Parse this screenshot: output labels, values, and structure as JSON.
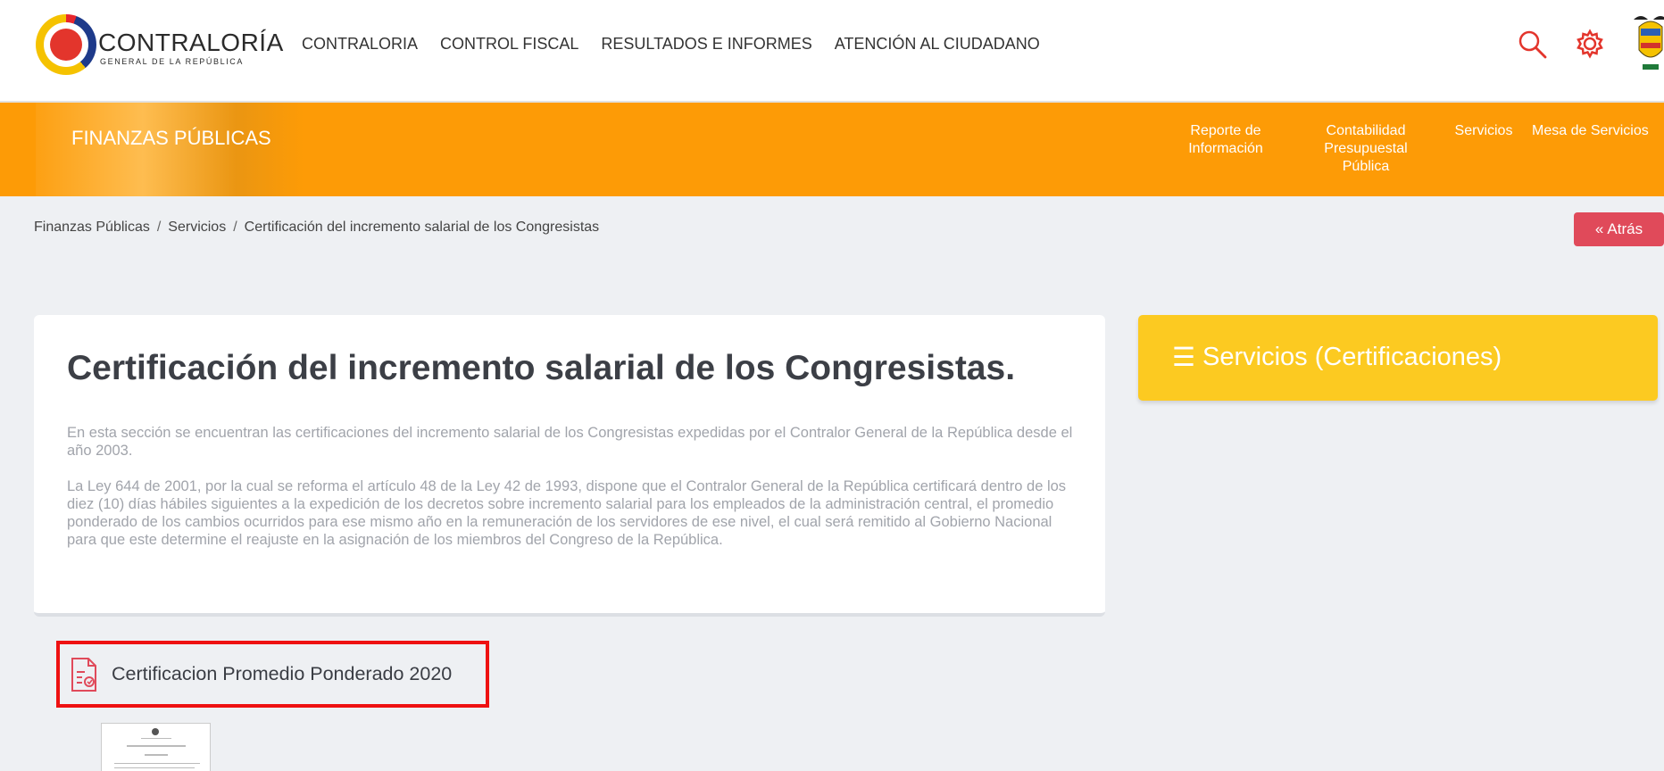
{
  "header": {
    "logo": {
      "title": "CONTRALORÍA",
      "subtitle": "GENERAL DE LA REPÚBLICA"
    },
    "nav": [
      "CONTRALORIA",
      "CONTROL FISCAL",
      "RESULTADOS E INFORMES",
      "ATENCIÓN AL CIUDADANO"
    ],
    "icons": {
      "search": "search-icon",
      "settings": "gear-icon",
      "crest": "coat-of-arms"
    },
    "accent_color": "#e3352c"
  },
  "band": {
    "title": "FINANZAS PÚBLICAS",
    "nav": [
      {
        "label": "Reporte de Información"
      },
      {
        "label": "Contabilidad Presupuestal Pública"
      },
      {
        "label": "Servicios"
      },
      {
        "label": "Mesa de Servicios"
      }
    ],
    "color": "#fd9b06"
  },
  "breadcrumb": [
    "Finanzas Públicas",
    "Servicios",
    "Certificación del incremento salarial de los Congresistas"
  ],
  "back_button": {
    "label": "Atrás",
    "icon": "«"
  },
  "main": {
    "title": "Certificación del incremento salarial de los Congresistas.",
    "paragraphs": [
      "En esta sección se encuentran las certificaciones del incremento salarial de los Congresistas expedidas por el Contralor General de la República desde el año 2003.",
      "La Ley 644 de 2001, por la cual se reforma el artículo 48 de la Ley 42 de 1993, dispone que el Contralor General de la República certificará dentro de los diez (10) días hábiles siguientes a la expedición de los decretos sobre incremento salarial para los empleados de la administración central, el promedio ponderado de los cambios ocurridos para ese mismo año en la remuneración de los servidores de ese nivel, el cual será remitido al Gobierno Nacional para que este determine el reajuste en la asignación de los miembros del Congreso de la República."
    ]
  },
  "side": {
    "label": "Servicios (Certificaciones)",
    "icon": "☰",
    "color": "#fcca21"
  },
  "document": {
    "label": "Certificacion Promedio Ponderado 2020",
    "icon": "document-icon"
  }
}
